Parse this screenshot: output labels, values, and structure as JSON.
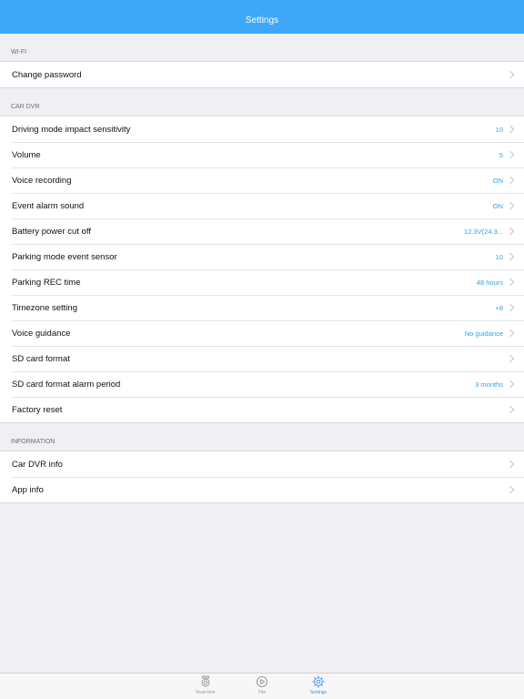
{
  "nav": {
    "title": "Settings"
  },
  "sections": {
    "wifi": {
      "header": "WI-FI",
      "rows": [
        {
          "label": "Change password",
          "value": ""
        }
      ]
    },
    "car_dvr": {
      "header": "CAR DVR",
      "rows": [
        {
          "label": "Driving mode impact sensitivity",
          "value": "10"
        },
        {
          "label": "Volume",
          "value": "5"
        },
        {
          "label": "Voice recording",
          "value": "ON"
        },
        {
          "label": "Event alarm sound",
          "value": "ON"
        },
        {
          "label": "Battery power cut off",
          "value": "12.3V(24.3..."
        },
        {
          "label": "Parking mode event sensor",
          "value": "10"
        },
        {
          "label": "Parking REC time",
          "value": "48 hours"
        },
        {
          "label": "Timezone setting",
          "value": "+8"
        },
        {
          "label": "Voice guidance",
          "value": "No guidance"
        },
        {
          "label": "SD card format",
          "value": ""
        },
        {
          "label": "SD card format alarm period",
          "value": "3 months"
        },
        {
          "label": "Factory reset",
          "value": ""
        }
      ]
    },
    "information": {
      "header": "INFORMATION",
      "rows": [
        {
          "label": "Car DVR info",
          "value": ""
        },
        {
          "label": "App info",
          "value": ""
        }
      ]
    }
  },
  "tabs": [
    {
      "label": "Real-time",
      "icon": "dashcam-icon",
      "active": false
    },
    {
      "label": "File",
      "icon": "play-icon",
      "active": false
    },
    {
      "label": "Settings",
      "icon": "gear-icon",
      "active": true
    }
  ],
  "colors": {
    "nav_background": "#3fa7f7",
    "value_text": "#2fa3e6",
    "active_tab": "#3b94e8",
    "background": "#efeff4"
  }
}
